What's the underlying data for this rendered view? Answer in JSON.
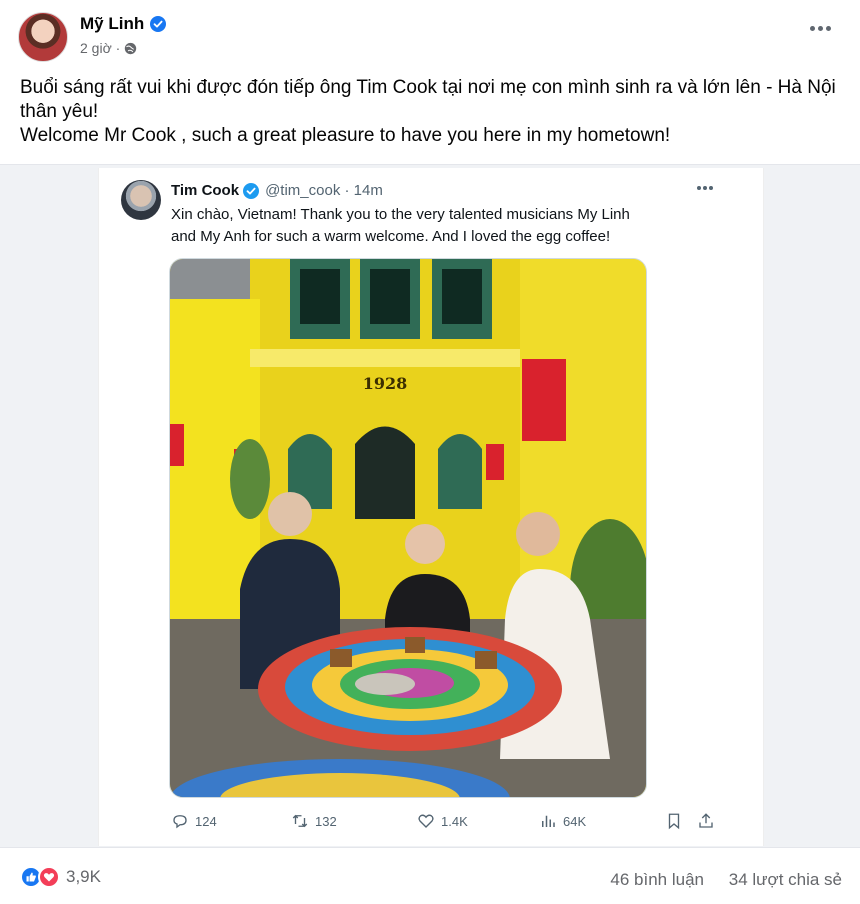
{
  "post": {
    "author": "Mỹ Linh",
    "time": "2 giờ ·",
    "text_line1": "Buổi sáng rất vui khi được đón tiếp ông Tim Cook tại nơi mẹ con mình sinh ra và lớn lên - Hà Nội thân yêu!",
    "text_line2": "Welcome Mr Cook , such a great pleasure to have you here in my hometown!"
  },
  "tweet": {
    "name": "Tim Cook",
    "handle": "@tim_cook · 14m",
    "text": "Xin chào, Vietnam! Thank you to the very talented musicians My Linh and My Anh for such a warm welcome. And I loved the egg coffee!",
    "photo_sign": "1928",
    "replies": "124",
    "retweets": "132",
    "likes": "1.4K",
    "views": "64K"
  },
  "footer": {
    "reaction_count": "3,9K",
    "comments": "46 bình luận",
    "shares": "34 lượt chia sẻ"
  },
  "colors": {
    "facebook_blue": "#1877f2",
    "heart_red": "#f33e58",
    "cafe_yellow": "#f3e21f",
    "shutter_green": "#2f6b55",
    "lantern_red": "#d9222d"
  },
  "icons": [
    "verified-icon",
    "globe-icon",
    "more-icon",
    "reply-icon",
    "retweet-icon",
    "like-icon",
    "views-icon",
    "bookmark-icon",
    "share-icon",
    "like-reaction-icon",
    "heart-reaction-icon"
  ]
}
